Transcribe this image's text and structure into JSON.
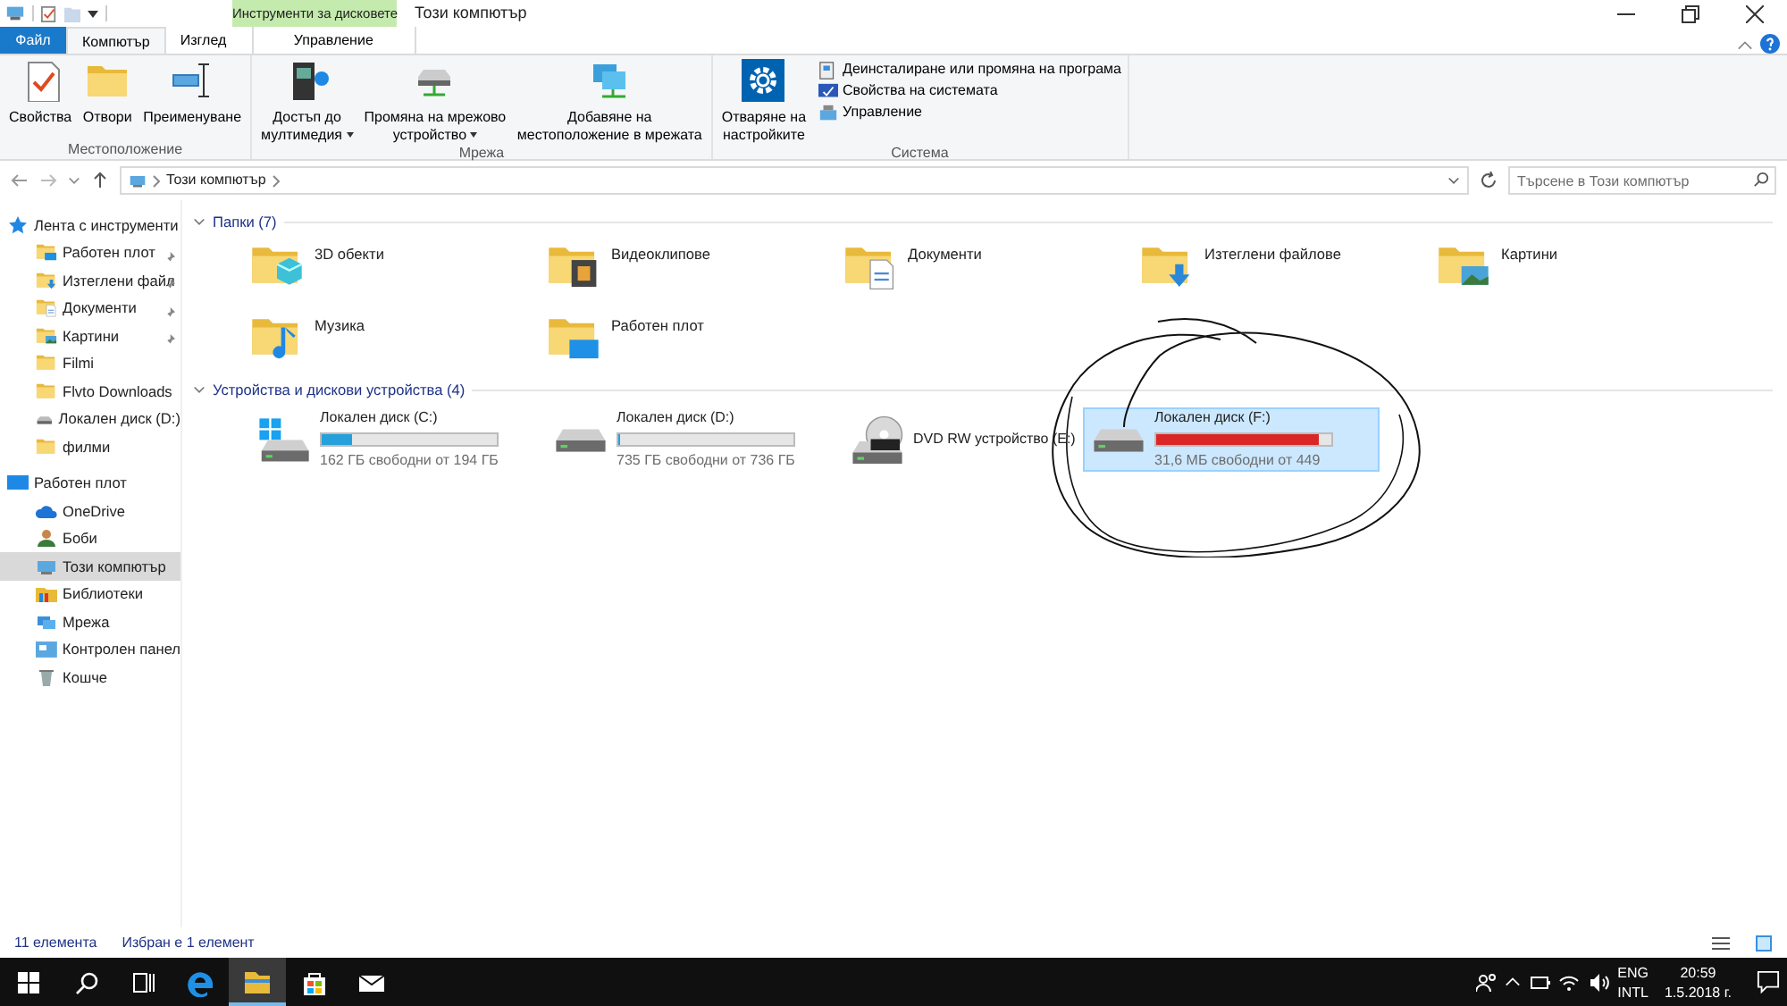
{
  "title_bar": {
    "title": "Този компютър",
    "context_header": "Инструменти за дисковете"
  },
  "ribbon": {
    "tabs": [
      {
        "label": "Файл",
        "kind": "file",
        "selected": false
      },
      {
        "label": "Компютър",
        "kind": "tab",
        "selected": true
      },
      {
        "label": "Изглед",
        "kind": "tab",
        "selected": false
      },
      {
        "label": "Управление",
        "kind": "context",
        "selected": false
      }
    ],
    "groups": [
      {
        "label": "Местоположение",
        "items": [
          {
            "label": "Свойства",
            "kind": "check",
            "dropdown": false
          },
          {
            "label": "Отвори",
            "kind": "folder",
            "dropdown": false
          },
          {
            "label": "Преименуване",
            "kind": "rename",
            "dropdown": false
          }
        ]
      },
      {
        "label": "Мрежа",
        "items": [
          {
            "label": "Достъп до\nмултимедия",
            "kind": "media",
            "dropdown": true
          },
          {
            "label": "Промяна на мрежово\nустройство",
            "kind": "netdrive",
            "dropdown": true
          },
          {
            "label": "Добавяне на\nместоположение в мрежата",
            "kind": "netloc",
            "dropdown": false
          }
        ]
      },
      {
        "label": "Система",
        "items": [
          {
            "label": "Отваряне на\nнастройките",
            "kind": "settings",
            "dropdown": false
          }
        ],
        "links": [
          {
            "label": "Деинсталиране или промяна на програма",
            "kind": "uninstall"
          },
          {
            "label": "Свойства на системата",
            "kind": "sysprops"
          },
          {
            "label": "Управление",
            "kind": "manage"
          }
        ]
      }
    ]
  },
  "address_bar": {
    "path": "Този компютър",
    "search_placeholder": "Търсене в Този компютър"
  },
  "sidebar": {
    "items": [
      {
        "label": "Лента с инструменти",
        "kind": "star",
        "selected": false,
        "children": [
          {
            "label": "Работен плот",
            "kind": "desktop",
            "pinned": true,
            "selected": false
          },
          {
            "label": "Изтеглени файл",
            "kind": "download",
            "pinned": true,
            "selected": false
          },
          {
            "label": "Документи",
            "kind": "document",
            "pinned": true,
            "selected": false
          },
          {
            "label": "Картини",
            "kind": "picture",
            "pinned": true,
            "selected": false
          },
          {
            "label": "Filmi",
            "kind": "folder",
            "pinned": false,
            "selected": false
          },
          {
            "label": "Flvto Downloads",
            "kind": "folder",
            "pinned": false,
            "selected": false
          },
          {
            "label": "Локален диск (D:)",
            "kind": "drive",
            "pinned": false,
            "selected": false
          },
          {
            "label": "филми",
            "kind": "folder",
            "pinned": false,
            "selected": false
          }
        ]
      },
      {
        "label": "Работен плот",
        "kind": "screen",
        "selected": false,
        "children": [
          {
            "label": "OneDrive",
            "kind": "cloud",
            "selected": false
          },
          {
            "label": "Боби",
            "kind": "user",
            "selected": false
          },
          {
            "label": "Този компютър",
            "kind": "computer",
            "selected": true
          },
          {
            "label": "Библиотеки",
            "kind": "library",
            "selected": false
          },
          {
            "label": "Мрежа",
            "kind": "network",
            "selected": false
          },
          {
            "label": "Контролен панел",
            "kind": "panel",
            "selected": false
          },
          {
            "label": "Кошче",
            "kind": "bin",
            "selected": false
          }
        ]
      }
    ]
  },
  "folders": {
    "header": "Папки (7)",
    "items": [
      {
        "label": "3D обекти",
        "kind": "cube"
      },
      {
        "label": "Видеоклипове",
        "kind": "video"
      },
      {
        "label": "Документи",
        "kind": "document"
      },
      {
        "label": "Изтеглени файлове",
        "kind": "download"
      },
      {
        "label": "Картини",
        "kind": "picture"
      },
      {
        "label": "Музика",
        "kind": "music"
      },
      {
        "label": "Работен плот",
        "kind": "desktop"
      }
    ]
  },
  "devices": {
    "header": "Устройства и дискови устройства (4)",
    "items": [
      {
        "label": "Локален диск (C:)",
        "kind": "system",
        "free": "162 ГБ свободни от 194 ГБ",
        "level": 0.17,
        "color": "#26a0da",
        "selected": false
      },
      {
        "label": "Локален диск (D:)",
        "kind": "drive",
        "free": "735 ГБ свободни от 736 ГБ",
        "level": 0.01,
        "color": "#26a0da",
        "selected": false
      },
      {
        "label": "DVD RW устройство (E:)",
        "kind": "dvd",
        "selected": false
      },
      {
        "label": "Локален диск (F:)",
        "kind": "drive",
        "free": "31,6 МБ свободни от 449",
        "level": 0.93,
        "color": "#da2626",
        "selected": true
      }
    ]
  },
  "status_bar": {
    "count": "11 елемента",
    "selection": "Избран е 1 елемент"
  },
  "taskbar": {
    "apps": [
      {
        "kind": "search",
        "selected": false
      },
      {
        "kind": "taskview",
        "selected": false
      },
      {
        "kind": "edge",
        "selected": false
      },
      {
        "kind": "explorer",
        "selected": true
      },
      {
        "kind": "store",
        "selected": false
      },
      {
        "kind": "mail",
        "selected": false
      }
    ],
    "language": "ENG",
    "layout": "INTL",
    "time": "20:59",
    "date": "1.5.2018 г."
  }
}
